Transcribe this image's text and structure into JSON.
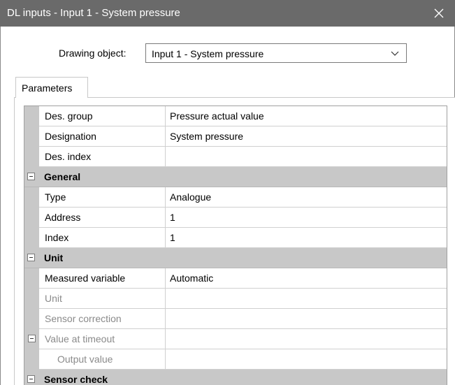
{
  "window": {
    "title": "DL inputs - Input 1 - System pressure"
  },
  "drawing_object": {
    "label": "Drawing object:",
    "value": "Input 1 - System pressure"
  },
  "tabs": [
    {
      "label": "Parameters"
    }
  ],
  "grid": {
    "rows": [
      {
        "name": "Des. group",
        "value": "Pressure actual value"
      },
      {
        "name": "Designation",
        "value": "System pressure"
      },
      {
        "name": "Des. index",
        "value": ""
      }
    ],
    "general": {
      "label": "General",
      "rows": [
        {
          "name": "Type",
          "value": "Analogue"
        },
        {
          "name": "Address",
          "value": "1"
        },
        {
          "name": "Index",
          "value": "1"
        }
      ]
    },
    "unit": {
      "label": "Unit",
      "rows": [
        {
          "name": "Measured variable",
          "value": "Automatic"
        },
        {
          "name": "Unit",
          "value": ""
        },
        {
          "name": "Sensor correction",
          "value": ""
        },
        {
          "name": "Value at timeout",
          "value": ""
        },
        {
          "name": "Output value",
          "value": ""
        }
      ]
    },
    "sensor_check": {
      "label": "Sensor check"
    }
  },
  "icons": {
    "close": "close-icon",
    "dropdown": "chevron-down-icon",
    "collapse": "minus-box-icon"
  },
  "colors": {
    "titlebar": "#6a6a6a",
    "category_bg": "#c8c8c8",
    "disabled_text": "#8a8a8a"
  }
}
